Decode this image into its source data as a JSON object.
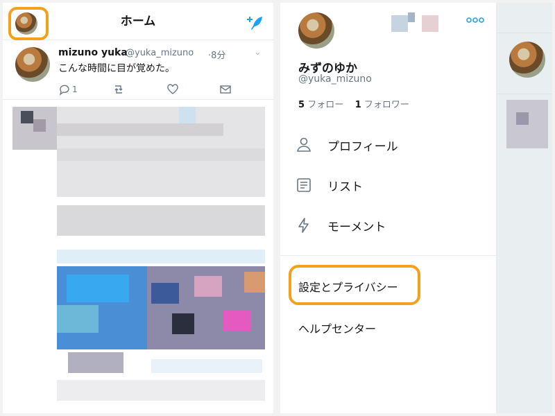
{
  "left": {
    "header": {
      "title": "ホーム"
    },
    "tweet": {
      "name": "mizuno yuka",
      "handle": "@yuka_mizuno",
      "time": "·8分",
      "text": "こんな時間に目が覚めた。",
      "reply_count": "1"
    }
  },
  "right": {
    "profile": {
      "name": "みずのゆか",
      "handle": "@yuka_mizuno",
      "following_count": "5",
      "following_label": "フォロー",
      "followers_count": "1",
      "followers_label": "フォロワー"
    },
    "menu": [
      {
        "label": "プロフィール",
        "icon": "person-icon"
      },
      {
        "label": "リスト",
        "icon": "list-icon"
      },
      {
        "label": "モーメント",
        "icon": "lightning-icon"
      }
    ],
    "settings_label": "設定とプライバシー",
    "help_label": "ヘルプセンター"
  },
  "colors": {
    "accent": "#1da1f2",
    "highlight": "#f5a01a"
  }
}
